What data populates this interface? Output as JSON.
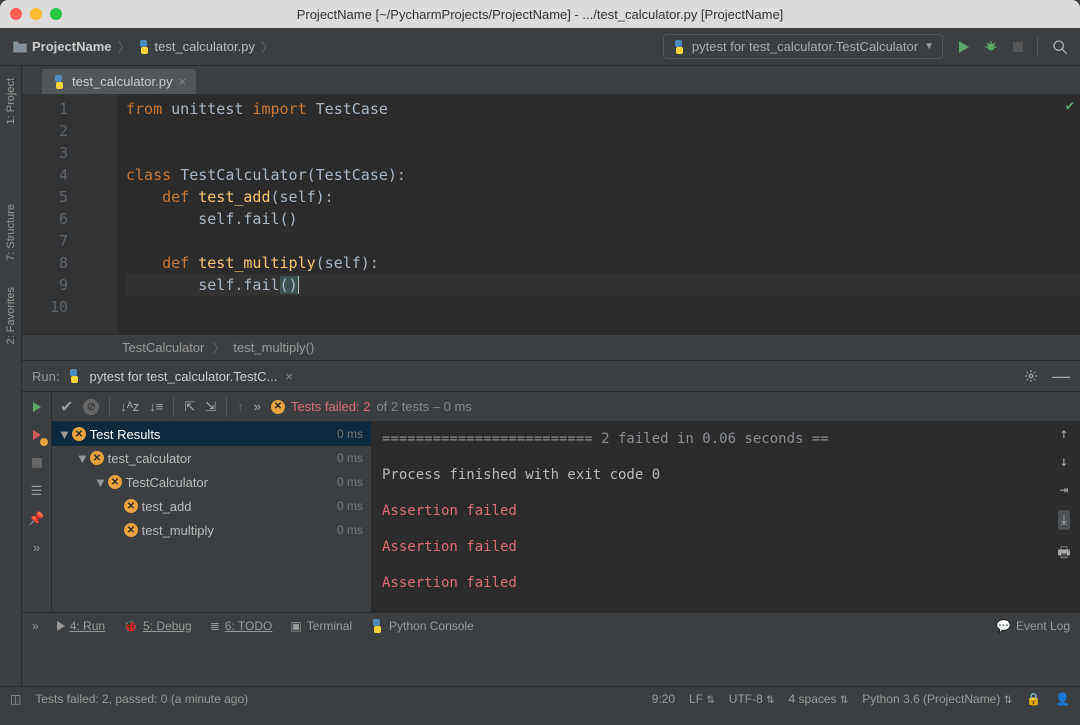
{
  "window": {
    "title": "ProjectName [~/PycharmProjects/ProjectName] - .../test_calculator.py [ProjectName]"
  },
  "navbar": {
    "breadcrumb_root": "ProjectName",
    "breadcrumb_file": "test_calculator.py",
    "run_config_label": "pytest for test_calculator.TestCalculator"
  },
  "sidebar": {
    "project": "1: Project",
    "structure": "7: Structure",
    "favorites": "2: Favorites"
  },
  "editor": {
    "tab_name": "test_calculator.py",
    "lines": [
      "1",
      "2",
      "3",
      "4",
      "5",
      "6",
      "7",
      "8",
      "9",
      "10"
    ],
    "code": {
      "l1_from": "from ",
      "l1_mod": "unittest ",
      "l1_import": "import ",
      "l1_tc": "TestCase",
      "l4_class": "class ",
      "l4_name": "TestCalculator",
      "l4_rest": "(TestCase):",
      "l5_def": "    def ",
      "l5_name": "test_add",
      "l5_rest": "(self):",
      "l6": "        self.fail()",
      "l8_def": "    def ",
      "l8_name": "test_multiply",
      "l8_rest": "(self):",
      "l9_pre": "        self.fail",
      "l9_open": "(",
      "l9_close": ")"
    },
    "crumb1": "TestCalculator",
    "crumb2": "test_multiply()"
  },
  "run_panel": {
    "label": "Run:",
    "config_name": "pytest for test_calculator.TestC...",
    "status_prefix": "Tests failed: 2",
    "status_suffix": " of 2 tests – 0 ms"
  },
  "tree": {
    "root": "Test Results",
    "root_time": "0 ms",
    "n1": "test_calculator",
    "n1_time": "0 ms",
    "n2": "TestCalculator",
    "n2_time": "0 ms",
    "n3": "test_add",
    "n3_time": "0 ms",
    "n4": "test_multiply",
    "n4_time": "0 ms"
  },
  "console": {
    "l1": "========================= 2 failed in 0.06 seconds ==",
    "l2": "Process finished with exit code 0",
    "l3": "Assertion failed",
    "l4": "Assertion failed",
    "l5": "Assertion failed"
  },
  "bottom": {
    "run": "4: Run",
    "debug": "5: Debug",
    "todo": "6: TODO",
    "terminal": "Terminal",
    "console": "Python Console",
    "event_log": "Event Log"
  },
  "status": {
    "msg": "Tests failed: 2, passed: 0 (a minute ago)",
    "pos": "9:20",
    "lf": "LF",
    "enc": "UTF-8",
    "indent": "4 spaces",
    "interp": "Python 3.6 (ProjectName)"
  }
}
